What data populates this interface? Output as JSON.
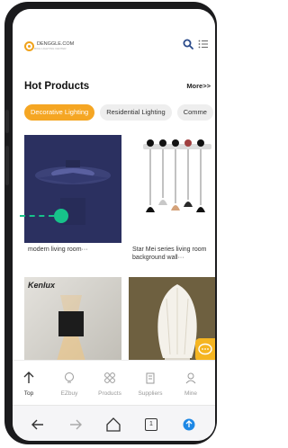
{
  "header": {
    "logo_text": "DENGGLE.COM",
    "logo_subtext": "RICH LIGHTING CENTER"
  },
  "section": {
    "title": "Hot Products",
    "more_label": "More>>"
  },
  "tabs": [
    {
      "label": "Decorative Lighting",
      "active": true
    },
    {
      "label": "Residential Lighting",
      "active": false
    },
    {
      "label": "Comme",
      "active": false
    }
  ],
  "products": [
    {
      "caption": "modern living room···",
      "image": "ceiling-fan-light-image"
    },
    {
      "caption": "Star Mei series living room background wall···",
      "image": "pendant-lights-image"
    },
    {
      "caption": "",
      "brand_overlay": "Kenlux",
      "image": "wall-cube-light-image"
    },
    {
      "caption": "",
      "image": "table-lamp-image"
    }
  ],
  "bottom_nav": [
    {
      "label": "Top",
      "icon": "arrow-up-icon"
    },
    {
      "label": "EZbuy",
      "icon": "bulb-icon"
    },
    {
      "label": "Products",
      "icon": "grid-icon"
    },
    {
      "label": "Suppliers",
      "icon": "building-icon"
    },
    {
      "label": "Mine",
      "icon": "user-icon"
    }
  ],
  "browser_bar": {
    "tab_count": "1"
  },
  "colors": {
    "accent": "#f5a623",
    "drag_hint": "#17c28a",
    "phone_frame": "#1b1b1d"
  }
}
